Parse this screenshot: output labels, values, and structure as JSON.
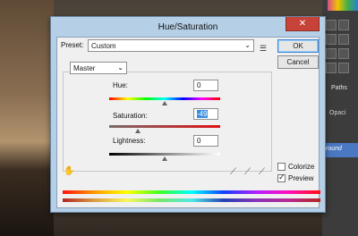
{
  "dialog": {
    "title": "Hue/Saturation",
    "close_glyph": "✕",
    "preset_label": "Preset:",
    "preset_value": "Custom",
    "ok_label": "OK",
    "cancel_label": "Cancel",
    "channel_value": "Master",
    "hue_label": "Hue:",
    "hue_value": "0",
    "saturation_label": "Saturation:",
    "saturation_value": "-49",
    "lightness_label": "Lightness:",
    "lightness_value": "0",
    "colorize_label": "Colorize",
    "colorize_checked": false,
    "preview_label": "Preview",
    "preview_checked": true
  },
  "sliders": {
    "hue": 0,
    "saturation": -49,
    "lightness": 0
  },
  "right_panel": {
    "tab_label": "Paths",
    "opacity_text": "Opaci",
    "layer_text": "round"
  },
  "icons": [
    "close-icon",
    "chevron-down-icon",
    "menu-icon",
    "hand-icon",
    "eyedropper-icon",
    "eyedropper-plus-icon",
    "eyedropper-minus-icon"
  ],
  "colors": {
    "dialog_frame": "#b5cfe6",
    "close_button": "#c7433a",
    "selection": "#3a8ee0",
    "layer_highlight": "#4a78c2"
  }
}
